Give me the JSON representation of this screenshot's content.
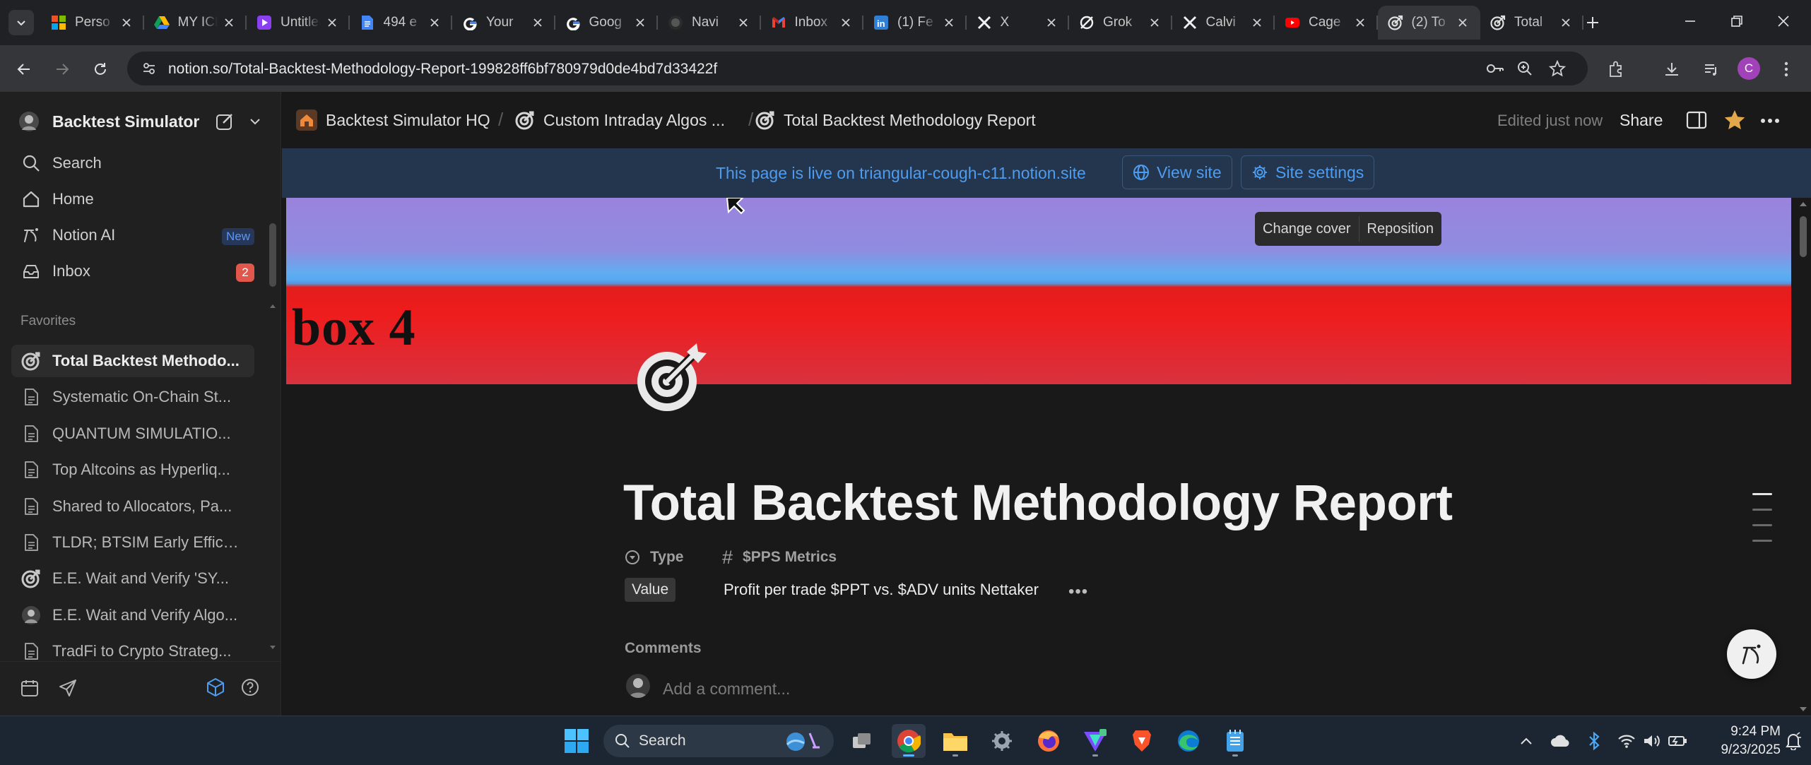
{
  "browser": {
    "tabs": [
      {
        "title": "Perso",
        "icon": "microsoft-icon"
      },
      {
        "title": "MY ICE",
        "icon": "google-drive-icon"
      },
      {
        "title": "Untitled",
        "icon": "video-icon"
      },
      {
        "title": "494 e",
        "icon": "google-docs-icon"
      },
      {
        "title": "Your",
        "icon": "google-icon"
      },
      {
        "title": "Goog",
        "icon": "google-icon"
      },
      {
        "title": "Navi",
        "icon": "github-icon"
      },
      {
        "title": "Inbox",
        "icon": "gmail-icon"
      },
      {
        "title": "(1) Fe",
        "icon": "linkedin-icon"
      },
      {
        "title": "X",
        "icon": "x-icon"
      },
      {
        "title": "Grok",
        "icon": "grok-icon"
      },
      {
        "title": "Calvi",
        "icon": "x-icon"
      },
      {
        "title": "Cage",
        "icon": "youtube-icon"
      },
      {
        "title": "(2) To",
        "icon": "target-icon",
        "active": true
      },
      {
        "title": "Total",
        "icon": "target-icon"
      }
    ],
    "url": "notion.so/Total-Backtest-Methodology-Report-199828ff6bf780979d0de4bd7d33422f",
    "profile_initial": "C"
  },
  "sidebar": {
    "workspace": "Backtest Simulator",
    "nav": [
      {
        "label": "Search",
        "icon": "search-icon"
      },
      {
        "label": "Home",
        "icon": "home-icon"
      },
      {
        "label": "Notion AI",
        "icon": "notion-ai-icon",
        "badge": "New"
      },
      {
        "label": "Inbox",
        "icon": "inbox-icon",
        "count": "2"
      }
    ],
    "favorites_heading": "Favorites",
    "favorites": [
      {
        "label": "Total Backtest Methodo...",
        "icon": "target-icon",
        "selected": true
      },
      {
        "label": "Systematic On-Chain St...",
        "icon": "page-icon"
      },
      {
        "label": "QUANTUM SIMULATIO...",
        "icon": "page-icon"
      },
      {
        "label": "Top Altcoins as Hyperliq...",
        "icon": "page-icon"
      },
      {
        "label": "Shared to Allocators, Pa...",
        "icon": "page-icon"
      },
      {
        "label": "TLDR; BTSIM Early Effica...",
        "icon": "page-icon"
      },
      {
        "label": "E.E. Wait and Verify 'SY...",
        "icon": "target-icon"
      },
      {
        "label": "E.E. Wait and Verify Algo...",
        "icon": "avatar-icon"
      },
      {
        "label": "TradFi to Crypto Strateg...",
        "icon": "page-icon"
      }
    ]
  },
  "topbar": {
    "breadcrumbs": [
      "Backtest Simulator HQ",
      "Custom Intraday Algos ...",
      "Total Backtest Methodology Report"
    ],
    "edited": "Edited just now",
    "share": "Share"
  },
  "banner": {
    "text": "This page is live on triangular-cough-c11.notion.site",
    "view_site": "View site",
    "site_settings": "Site settings"
  },
  "cover": {
    "text": "box 4",
    "change_cover": "Change cover",
    "reposition": "Reposition"
  },
  "page": {
    "title": "Total Backtest Methodology Report",
    "prop_type_label": "Type",
    "prop_metric_label": "$PPS Metrics",
    "type_value": "Value",
    "metric_value": "Profit per trade $PPT vs. $ADV units Nettaker",
    "more": "•••",
    "comments_heading": "Comments",
    "comment_placeholder": "Add a comment..."
  },
  "taskbar": {
    "search": "Search",
    "time": "9:24 PM",
    "date": "9/23/2025"
  },
  "colors": {
    "accent_blue": "#4e9cf0",
    "badge_red": "#e2574c",
    "profile_purple": "#a142b8"
  }
}
